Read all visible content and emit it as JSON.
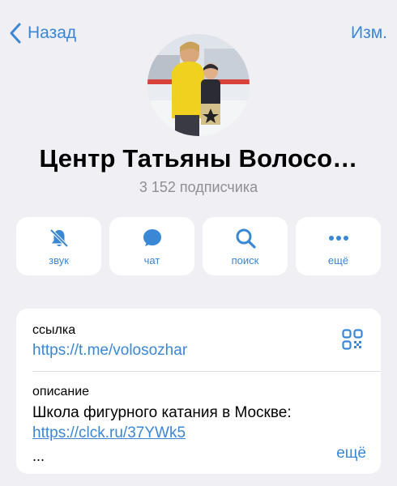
{
  "nav": {
    "back_label": "Назад",
    "edit_label": "Изм."
  },
  "channel": {
    "title": "Центр Татьяны Волосо…",
    "subscribers": "3 152 подписчика"
  },
  "actions": [
    {
      "label": "звук",
      "icon": "bell-slash-icon"
    },
    {
      "label": "чат",
      "icon": "chat-bubble-icon"
    },
    {
      "label": "поиск",
      "icon": "search-icon"
    },
    {
      "label": "ещё",
      "icon": "more-dots-icon"
    }
  ],
  "info": {
    "link_label": "ссылка",
    "link_value": "https://t.me/volosozhar",
    "description_label": "описание",
    "description_text": "Школа фигурного катания в Москве:",
    "description_link": "https://clck.ru/37YWk5",
    "description_ellipsis": "...",
    "more_label": "ещё"
  },
  "colors": {
    "accent": "#3a87d6",
    "background": "#efeff4",
    "card": "#ffffff",
    "secondary_text": "#8e8e93"
  }
}
